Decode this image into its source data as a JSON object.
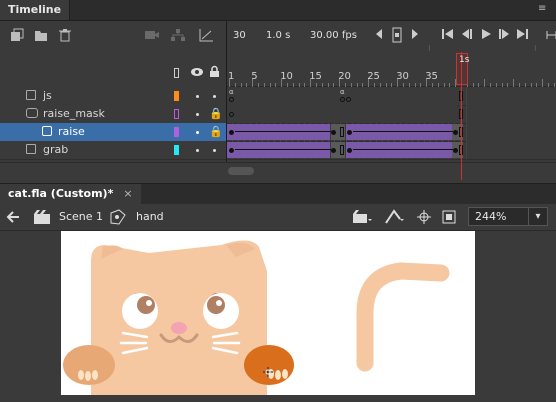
{
  "timeline_panel": {
    "tab_title": "Timeline",
    "toolbar": {
      "icons": [
        "new-layer-icon",
        "new-folder-icon",
        "delete-icon",
        "camera-icon",
        "layer-depth-icon",
        "graph-icon"
      ],
      "fps_frame": "30",
      "duration": "1.0",
      "duration_unit": "s",
      "fps_value": "30.00",
      "fps_unit": "fps"
    },
    "header_icons": [
      "outline-icon",
      "eye-icon",
      "lock-icon"
    ],
    "ruler": {
      "numbers": [
        "1",
        "5",
        "10",
        "15",
        "20",
        "25",
        "30",
        "35"
      ],
      "playhead_frame": "30",
      "playhead_time": "1s"
    },
    "layers": [
      {
        "name": "js",
        "swatch": "#ff8c1a",
        "type": "layer"
      },
      {
        "name": "raise_mask",
        "swatch": "#c058e0",
        "type": "mask"
      },
      {
        "name": "raise",
        "swatch": "#b060e0",
        "type": "masked",
        "selected": true
      },
      {
        "name": "grab",
        "swatch": "#25e8f0",
        "type": "layer"
      }
    ],
    "colors": {
      "tween": "#7a5aa8",
      "playhead": "#d03030",
      "selection": "#3a6ea8"
    }
  },
  "stage_panel": {
    "doc_tab": "cat.fla (Custom)*",
    "close_glyph": "×",
    "scene_label": "Scene 1",
    "symbol_label": "hand",
    "zoom_value": "244%",
    "zoom_dropdown": "▾"
  }
}
